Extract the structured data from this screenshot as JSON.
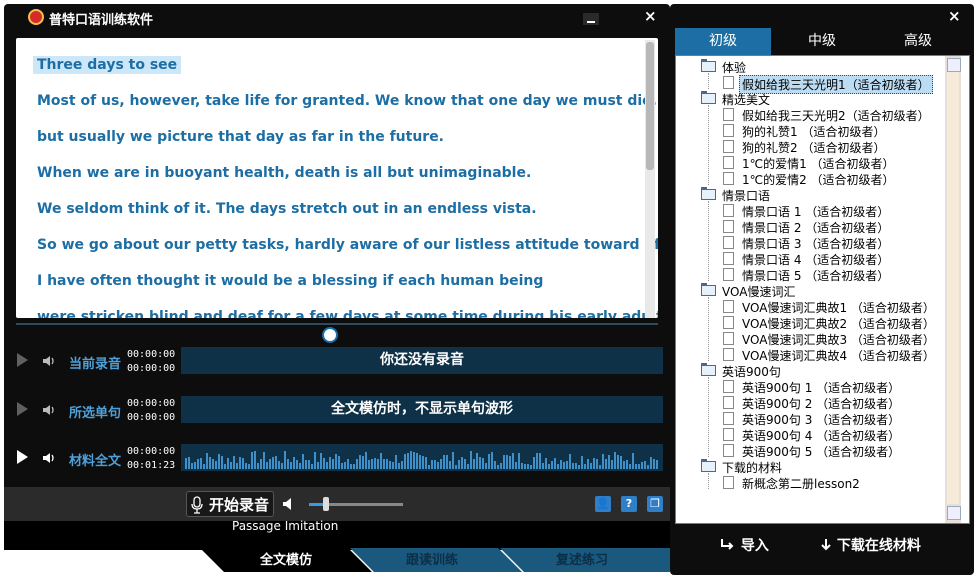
{
  "app": {
    "title": "普特口语训练软件",
    "close_glyph": "×"
  },
  "passage": {
    "lines": [
      "Three days to see",
      "Most of us, however, take life for granted. We know that one day we must die,",
      "but usually we picture that day as far in the future.",
      "When we are in buoyant health, death is all but unimaginable.",
      "We seldom think of it. The days stretch out in an endless vista.",
      "So we go about our petty tasks, hardly aware of our listless attitude toward life.",
      "I have often thought it would be a blessing if each human being",
      "were stricken blind and deaf for a few days at some time during his early adult life."
    ]
  },
  "rows": {
    "current_recording": {
      "label": "当前录音",
      "time_elapsed": "00:00:00",
      "time_total": "00:00:00",
      "message": "你还没有录音"
    },
    "selected_sentence": {
      "label": "所选单句",
      "time_elapsed": "00:00:00",
      "time_total": "00:00:00",
      "message": "全文模仿时，不显示单句波形"
    },
    "full_text": {
      "label": "材料全文",
      "time_elapsed": "00:00:00",
      "time_total": "00:01:23"
    }
  },
  "toolbar": {
    "record_label": "开始录音",
    "volume_level": 0.18,
    "user_glyph": "👤",
    "help_glyph": "?",
    "window_glyph": "❐"
  },
  "mode": {
    "subtitle_en": "Passage Imitation",
    "tabs": [
      "全文模仿",
      "跟读训练",
      "复述练习"
    ],
    "active_tab": 0
  },
  "sidebar": {
    "level_tabs": [
      "初级",
      "中级",
      "高级"
    ],
    "active_level": 0,
    "tree": [
      {
        "folder": "体验",
        "items": [
          "假如给我三天光明1（适合初级者）"
        ]
      },
      {
        "folder": "精选美文",
        "items": [
          "假如给我三天光明2（适合初级者）",
          "狗的礼赞1 （适合初级者）",
          "狗的礼赞2 （适合初级者）",
          "1℃的爱情1 （适合初级者）",
          "1℃的爱情2 （适合初级者）"
        ]
      },
      {
        "folder": "情景口语",
        "items": [
          "情景口语 1 （适合初级者）",
          "情景口语 2 （适合初级者）",
          "情景口语 3 （适合初级者）",
          "情景口语 4 （适合初级者）",
          "情景口语 5 （适合初级者）"
        ]
      },
      {
        "folder": "VOA慢速词汇",
        "items": [
          "VOA慢速词汇典故1 （适合初级者）",
          "VOA慢速词汇典故2 （适合初级者）",
          "VOA慢速词汇典故3 （适合初级者）",
          "VOA慢速词汇典故4 （适合初级者）"
        ]
      },
      {
        "folder": "英语900句",
        "items": [
          "英语900句 1 （适合初级者）",
          "英语900句 2 （适合初级者）",
          "英语900句 3 （适合初级者）",
          "英语900句 4 （适合初级者）",
          "英语900句 5 （适合初级者）"
        ]
      },
      {
        "folder": "下载的材料",
        "items": [
          "新概念第二册lesson2"
        ]
      }
    ],
    "import_label": "导入",
    "download_label": "下载在线材料"
  },
  "colors": {
    "accent": "#1c6ea4",
    "text_blue": "#1c6ea4",
    "label_blue": "#4fa0d8",
    "panel_bg": "#0d0d0d"
  }
}
